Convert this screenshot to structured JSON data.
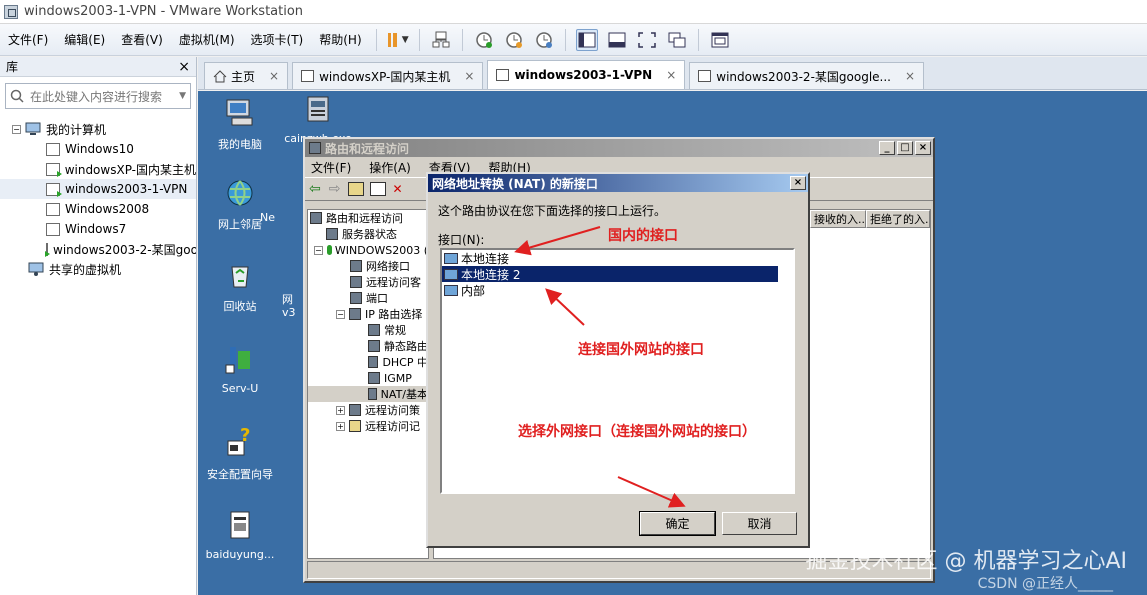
{
  "window": {
    "title": "windows2003-1-VPN - VMware Workstation"
  },
  "menubar": {
    "items": [
      "文件(F)",
      "编辑(E)",
      "查看(V)",
      "虚拟机(M)",
      "选项卡(T)",
      "帮助(H)"
    ]
  },
  "library": {
    "title": "库",
    "close": "×",
    "search_placeholder": "在此处键入内容进行搜索",
    "root": "我的计算机",
    "vms": [
      "Windows10",
      "windowsXP-国内某主机",
      "windows2003-1-VPN",
      "Windows2008",
      "Windows7",
      "windows2003-2-某国google"
    ],
    "shared": "共享的虚拟机"
  },
  "tabs": [
    {
      "label": "主页"
    },
    {
      "label": "windowsXP-国内某主机"
    },
    {
      "label": "windows2003-1-VPN"
    },
    {
      "label": "windows2003-2-某国google..."
    }
  ],
  "tab_close": "×",
  "desktop": {
    "icons": [
      "我的电脑",
      "cainzwh.exe",
      "网上邻居",
      "Ne",
      "回收站",
      "网",
      "v3",
      "Serv-U",
      "安全配置向导",
      "baiduyung..."
    ]
  },
  "rras": {
    "title": "路由和远程访问",
    "menu": [
      "文件(F)",
      "操作(A)",
      "查看(V)",
      "帮助(H)"
    ],
    "tree": [
      "路由和远程访问",
      "服务器状态",
      "WINDOWS2003 (",
      "网络接口",
      "远程访问客",
      "端口",
      "IP 路由选择",
      "常规",
      "静态路由",
      "DHCP 中",
      "IGMP",
      "NAT/基本",
      "远程访问策",
      "远程访问记"
    ],
    "columns": [
      "接收的入...",
      "拒绝了的入..."
    ]
  },
  "nat_dialog": {
    "title": "网络地址转换 (NAT) 的新接口",
    "description": "这个路由协议在您下面选择的接口上运行。",
    "list_label": "接口(N):",
    "interfaces": [
      "本地连接",
      "本地连接 2",
      "内部"
    ],
    "selected_index": 1,
    "ok": "确定",
    "cancel": "取消"
  },
  "annotations": {
    "domestic": "国内的接口",
    "foreign": "连接国外网站的接口",
    "choose": "选择外网接口（连接国外网站的接口）"
  },
  "watermark": "掘金技术社区 @ 机器学习之心AI",
  "watermark2": "CSDN @正经人_____",
  "colors": {
    "desktop": "#3a6ea5",
    "titlebar_active": "#0a246a",
    "annotation": "#e02020",
    "selection": "#0a246a"
  }
}
